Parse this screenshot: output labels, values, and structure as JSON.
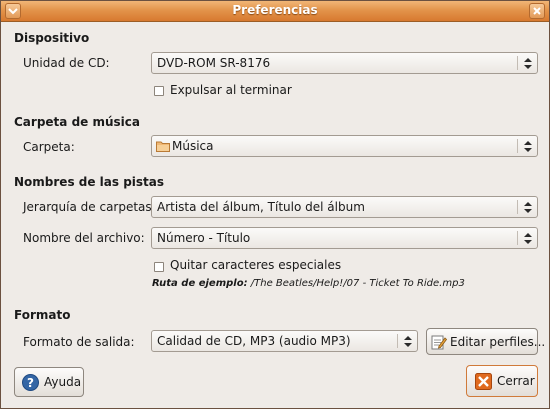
{
  "window": {
    "title": "Preferencias"
  },
  "device": {
    "heading": "Dispositivo",
    "cd_label": "Unidad de CD:",
    "cd_value": "DVD-ROM SR-8176",
    "eject_label": "Expulsar al terminar",
    "eject_checked": false
  },
  "music": {
    "heading": "Carpeta de música",
    "folder_label": "Carpeta:",
    "folder_value": "Música"
  },
  "tracks": {
    "heading": "Nombres de las pistas",
    "hierarchy_label": "Jerarquía de carpetas:",
    "hierarchy_value": "Artista del álbum, Título del álbum",
    "filename_label": "Nombre del archivo:",
    "filename_value": "Número - Título",
    "strip_label": "Quitar caracteres especiales",
    "strip_checked": false,
    "example_label": "Ruta de ejemplo:",
    "example_value": "/The Beatles/Help!/07 - Ticket To Ride.mp3"
  },
  "format": {
    "heading": "Formato",
    "output_label": "Formato de salida:",
    "output_value": "Calidad de CD, MP3 (audio MP3)",
    "edit_profiles_label": "Editar perfiles..."
  },
  "buttons": {
    "help": "Ayuda",
    "close": "Cerrar"
  },
  "colors": {
    "titlebar": "#e3944b",
    "close_icon": "#e06a1f",
    "help_icon": "#3466a5"
  }
}
